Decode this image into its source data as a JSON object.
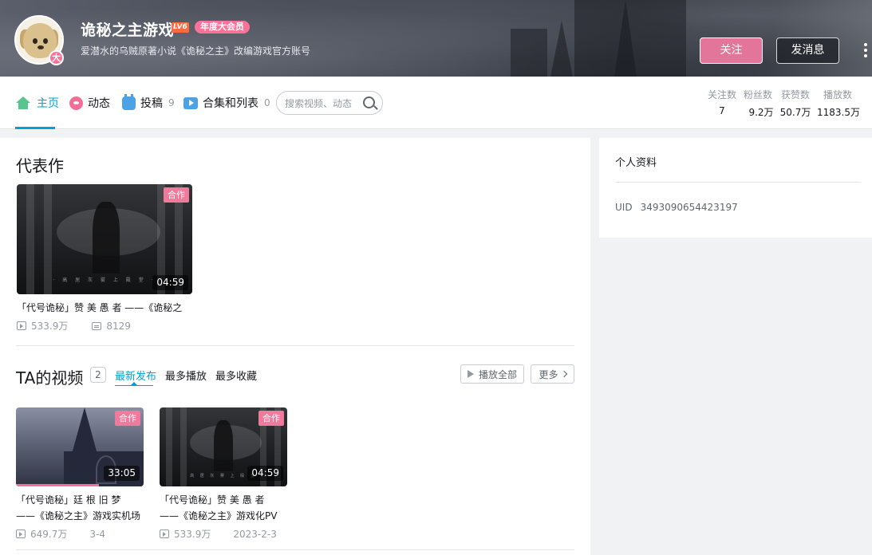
{
  "header": {
    "username": "诡秘之主游戏",
    "level": "LV6",
    "vip_label": "年度大会员",
    "avatar_badge": "大",
    "signature": "爱潜水的乌贼原著小说《诡秘之主》改编游戏官方账号",
    "follow_label": "关注",
    "message_label": "发消息"
  },
  "nav": {
    "home": "主页",
    "dynamic": "动态",
    "uploads": "投稿",
    "uploads_count": "9",
    "collections": "合集和列表",
    "collections_count": "0",
    "search_placeholder": "搜索视频、动态"
  },
  "stats": [
    {
      "label": "关注数",
      "value": "7"
    },
    {
      "label": "粉丝数",
      "value": "9.2万"
    },
    {
      "label": "获赞数",
      "value": "50.7万"
    },
    {
      "label": "播放数",
      "value": "1183.5万"
    }
  ],
  "masterpiece": {
    "section_title": "代表作",
    "video": {
      "badge": "合作",
      "duration": "04:59",
      "title": "「代号诡秘」赞 美 愚 者 ——《诡秘之",
      "views": "533.9万",
      "danmaku": "8129",
      "cover_caption": "· 高 居 灰 雾 上 殿 堂 ·"
    }
  },
  "ta_videos": {
    "section_title": "TA的视频",
    "count": "2",
    "tabs": [
      "最新发布",
      "最多播放",
      "最多收藏"
    ],
    "active_tab": 0,
    "play_all_label": "播放全部",
    "more_label": "更多",
    "videos": [
      {
        "badge": "合作",
        "duration": "33:05",
        "title_line1": "「代号诡秘」廷 根 旧 梦",
        "title_line2": "——《诡秘之主》游戏实机场",
        "views": "649.7万",
        "date": "3-4",
        "progress": 0.65
      },
      {
        "badge": "合作",
        "duration": "04:59",
        "title_line1": "「代号诡秘」赞 美 愚 者",
        "title_line2": "——《诡秘之主》游戏化PV",
        "views": "533.9万",
        "date": "2023-2-3",
        "cover_caption": "高 居 灰 雾 上 殿 堂"
      }
    ]
  },
  "profile": {
    "title": "个人资料",
    "uid_label": "UID",
    "uid_value": "3493090654423197"
  },
  "colors": {
    "accent_blue": "#00a1d6",
    "pink": "#fb7299",
    "follow_bg": "#e3749a"
  }
}
